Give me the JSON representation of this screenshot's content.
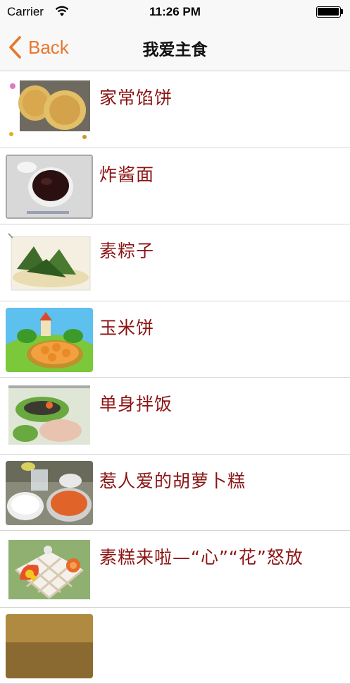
{
  "status_bar": {
    "carrier": "Carrier",
    "time": "11:26 PM"
  },
  "nav": {
    "back_label": "Back",
    "title": "我爱主食"
  },
  "colors": {
    "accent": "#e8762c",
    "item_text": "#8b1414"
  },
  "items": [
    {
      "label": "家常馅饼"
    },
    {
      "label": "炸酱面"
    },
    {
      "label": "素粽子"
    },
    {
      "label": "玉米饼"
    },
    {
      "label": "单身拌饭"
    },
    {
      "label": "惹人爱的胡萝卜糕"
    },
    {
      "label": "素糕来啦—“心”“花”怒放"
    }
  ]
}
